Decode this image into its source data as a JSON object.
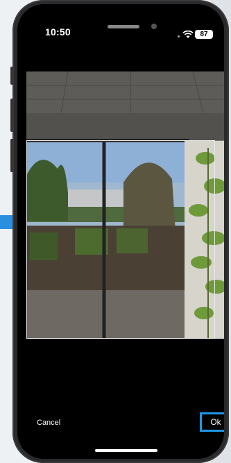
{
  "status_bar": {
    "time": "10:50",
    "battery_level": "87",
    "wifi_icon": "wifi-icon",
    "battery_icon": "battery-icon"
  },
  "editor": {
    "image_subject": "Office window view with plant",
    "cancel_label": "Cancel",
    "ok_label": "Ok"
  },
  "colors": {
    "accent": "#1d98e8",
    "screen_bg": "#000000"
  }
}
